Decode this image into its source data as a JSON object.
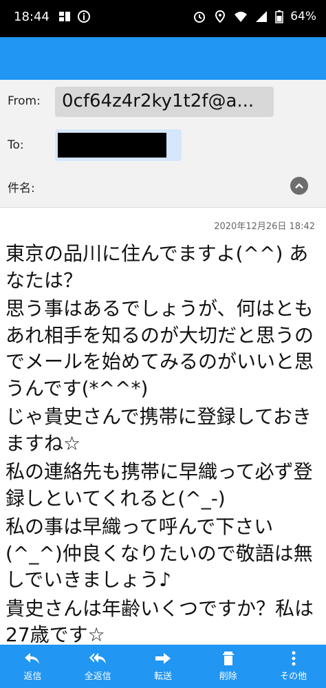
{
  "status_bar": {
    "time": "18:44",
    "battery": "64%",
    "icons": [
      "grid-icon",
      "info-icon",
      "alarm-icon",
      "location-icon",
      "wifi-icon",
      "signal-icon",
      "battery-icon"
    ]
  },
  "header": {
    "from_label": "From:",
    "from_value": "0cf64z4r2ky1t2f@a...",
    "to_label": "To:",
    "subject_label": "件名:"
  },
  "message": {
    "date": "2020年12月26日 18:42",
    "lines": [
      "東京の品川に住んでますよ(^^) あなたは？",
      "思う事はあるでしょうが、何はともあれ相手を知るのが大切だと思うのでメールを始めてみるのがいいと思うんです(*^^*)",
      "じゃ貴史さんで携帯に登録しておきますね☆",
      "私の連絡先も携帯に早織って必ず登録しといてくれると(^_-)",
      "私の事は早織って呼んで下さい(^_^)仲良くなりたいので敬語は無しでいきましょう♪",
      "貴史さんは年齢いくつですか？私は27歳です☆"
    ]
  },
  "toolbar": {
    "reply": "返信",
    "reply_all": "全返信",
    "forward": "転送",
    "delete": "削除",
    "more": "その他"
  },
  "colors": {
    "accent": "#2196f3",
    "header_bg": "#f2f2f2"
  }
}
